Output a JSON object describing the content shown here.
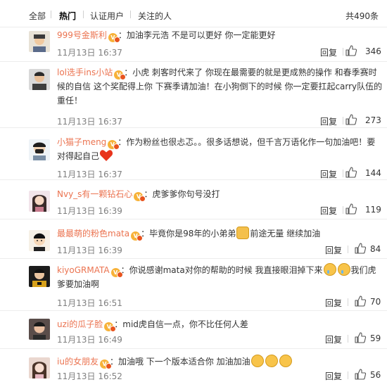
{
  "filter": {
    "tabs": [
      "全部",
      "热门",
      "认证用户",
      "关注的人"
    ],
    "active": "热门",
    "total": "共490条"
  },
  "ui": {
    "reply_label": "回复",
    "icon_like": "thumbs-up-icon",
    "icon_vip": "vip-badge-icon"
  },
  "colors": {
    "username": "#eb7350",
    "time": "#808080",
    "text": "#333333",
    "divider": "#ededed"
  },
  "comments": [
    {
      "user": "999号金斯利",
      "text": "：加油李元浩 不是可以更好 你一定能更好",
      "time": "11月13日 16:37",
      "likes": "346"
    },
    {
      "user": "lol选手ins小站",
      "text": "：小虎 刺客时代来了 你现在最需要的就是更成熟的操作 和春季赛时候的自信 这个奖配得上你 下赛季请加油！在小狗倒下的时候 你一定要扛起carry队伍的重任！",
      "time": "11月13日 16:37",
      "likes": "273"
    },
    {
      "user": "小猫子meng",
      "text": "：作为粉丝也很忐忑。。很多话想说，但千言万语化作一句加油吧！要对得起自己",
      "time": "11月13日 16:37",
      "likes": "144"
    },
    {
      "user": "Nvy_s有一颗钻石心",
      "text": "：虎爹爹你句号没打",
      "time": "11月13日 16:39",
      "likes": "119"
    },
    {
      "user": "最最萌的粉色mata",
      "text_before": "：毕竟你是98年的小弟弟",
      "text_after": "前途无量 继续加油",
      "time": "11月13日 16:39",
      "likes": "84"
    },
    {
      "user": "kiyoGRMATA",
      "text_before": "：你说感谢mata对你的帮助的时候 我直接眼泪掉下来",
      "text_after": "我们虎爹要加油啊",
      "time": "11月13日 16:51",
      "likes": "70"
    },
    {
      "user": "uzi的瓜子脸",
      "text": "：mid虎自信一点，你不比任何人差",
      "time": "11月13日 16:49",
      "likes": "59"
    },
    {
      "user": "iu的女朋友",
      "text": "：加油哦 下一个版本适合你 加油加油",
      "time": "11月13日 16:52",
      "likes": "56"
    }
  ]
}
